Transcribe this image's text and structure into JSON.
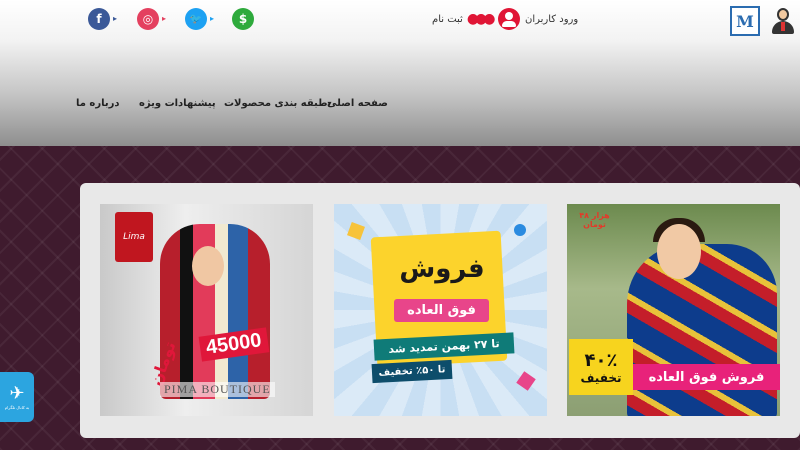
{
  "header": {
    "social": {
      "facebook": "f",
      "instagram": "◎",
      "twitter": "🐦",
      "money": "$"
    },
    "signup_label": "ثبت نام",
    "login_label": "ورود کاربران",
    "logo_letters": "M"
  },
  "nav": {
    "home": "صفحه اصلی",
    "categories": "طبقه بندی محصولات",
    "offers": "پیشنهادات ویژه",
    "about": "درباره ما"
  },
  "banners": {
    "left": {
      "brand": "Lima",
      "price": "45000",
      "toman": "تومان",
      "boutique": "PIMA BOUTIQUE"
    },
    "middle": {
      "title": "فروش",
      "subtitle": "فوق العاده",
      "extended": "تا ۲۷ بهمن تمدید شد",
      "discount": "تا ۵۰٪ تخفیف"
    },
    "right": {
      "badge": "۴۸ هزار تومان",
      "percent": "۴۰٪",
      "percent_label": "تخفیف",
      "sale": "فروش فوق العاده"
    }
  },
  "telegram": {
    "label": "به کانال تلگرام"
  },
  "colors": {
    "accent_red": "#e01535",
    "pattern": "#3f1b2e",
    "telegram": "#2ca5e0"
  }
}
